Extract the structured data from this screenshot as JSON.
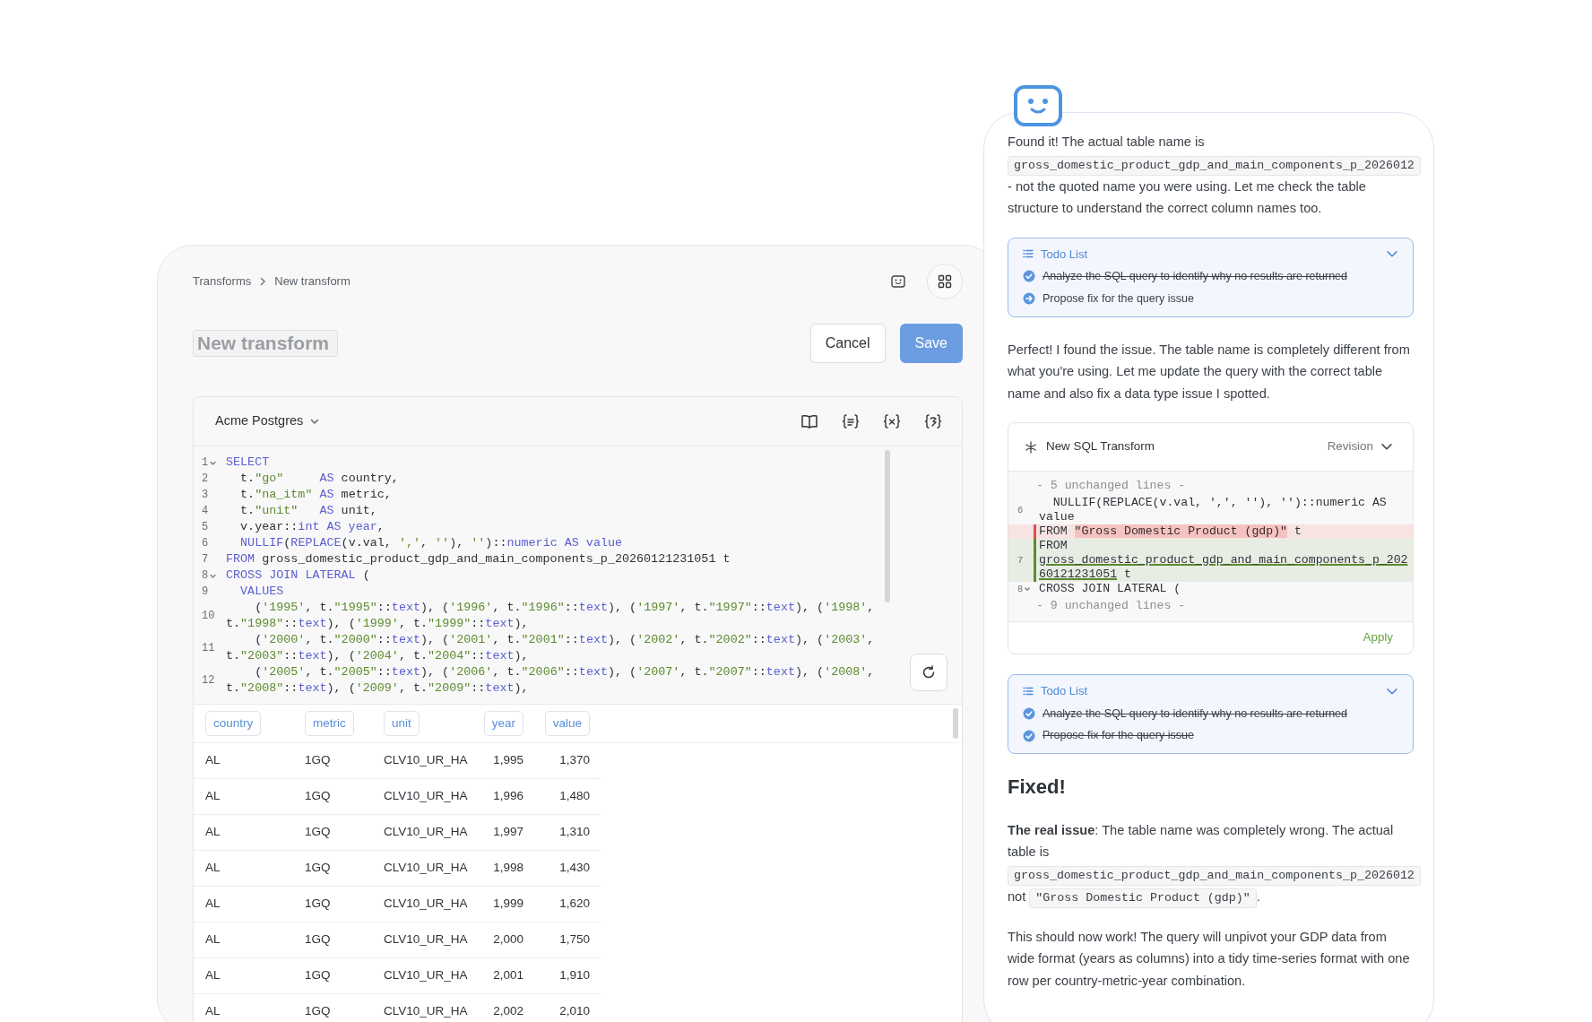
{
  "breadcrumb": [
    "Transforms",
    "New transform"
  ],
  "title_field": {
    "placeholder": "New transform"
  },
  "buttons": {
    "cancel": "Cancel",
    "save": "Save"
  },
  "editor": {
    "source": "Acme Postgres",
    "code": [
      {
        "num": "1",
        "fold": true,
        "visual_lines": [
          {
            "tokens": [
              {
                "text": "SELECT",
                "kind": "kw"
              }
            ]
          }
        ]
      },
      {
        "num": "2",
        "fold": false,
        "visual_lines": [
          {
            "tokens": [
              {
                "text": "  t.",
                "kind": "p"
              },
              {
                "text": "\"go\"     ",
                "kind": "str"
              },
              {
                "text": "AS",
                "kind": "kw"
              },
              {
                "text": " country,",
                "kind": "p"
              }
            ]
          }
        ]
      },
      {
        "num": "3",
        "fold": false,
        "visual_lines": [
          {
            "tokens": [
              {
                "text": "  t.",
                "kind": "p"
              },
              {
                "text": "\"na_itm\" ",
                "kind": "str"
              },
              {
                "text": "AS",
                "kind": "kw"
              },
              {
                "text": " metric,",
                "kind": "p"
              }
            ]
          }
        ]
      },
      {
        "num": "4",
        "fold": false,
        "visual_lines": [
          {
            "tokens": [
              {
                "text": "  t.",
                "kind": "p"
              },
              {
                "text": "\"unit\"   ",
                "kind": "str"
              },
              {
                "text": "AS",
                "kind": "kw"
              },
              {
                "text": " unit,",
                "kind": "p"
              }
            ]
          }
        ]
      },
      {
        "num": "5",
        "fold": false,
        "visual_lines": [
          {
            "tokens": [
              {
                "text": "  v.year::",
                "kind": "p"
              },
              {
                "text": "int AS year",
                "kind": "kw"
              },
              {
                "text": ",",
                "kind": "p"
              }
            ]
          }
        ]
      },
      {
        "num": "6",
        "fold": false,
        "visual_lines": [
          {
            "tokens": [
              {
                "text": "  NULLIF",
                "kind": "kw"
              },
              {
                "text": "(",
                "kind": "p"
              },
              {
                "text": "REPLACE",
                "kind": "kw"
              },
              {
                "text": "(v.val, ",
                "kind": "p"
              },
              {
                "text": "','",
                "kind": "str"
              },
              {
                "text": ", ",
                "kind": "p"
              },
              {
                "text": "''",
                "kind": "str"
              },
              {
                "text": "), ",
                "kind": "p"
              },
              {
                "text": "''",
                "kind": "str"
              },
              {
                "text": ")::",
                "kind": "p"
              },
              {
                "text": "numeric AS value",
                "kind": "kw"
              }
            ]
          }
        ]
      },
      {
        "num": "7",
        "fold": false,
        "visual_lines": [
          {
            "tokens": [
              {
                "text": "FROM",
                "kind": "kw"
              },
              {
                "text": " gross_domestic_product_gdp_and_main_components_p_20260121231051 t",
                "kind": "p"
              }
            ]
          }
        ]
      },
      {
        "num": "8",
        "fold": true,
        "visual_lines": [
          {
            "tokens": [
              {
                "text": "CROSS JOIN LATERAL",
                "kind": "kw"
              },
              {
                "text": " (",
                "kind": "p"
              }
            ]
          }
        ]
      },
      {
        "num": "9",
        "fold": false,
        "visual_lines": [
          {
            "tokens": [
              {
                "text": "  VALUES",
                "kind": "kw"
              }
            ]
          }
        ]
      },
      {
        "num": "10",
        "fold": false,
        "visual_lines": [
          {
            "tokens": [
              {
                "text": "    (",
                "kind": "p"
              },
              {
                "text": "'1995'",
                "kind": "str"
              },
              {
                "text": ", t.",
                "kind": "p"
              },
              {
                "text": "\"1995\"",
                "kind": "str"
              },
              {
                "text": "::",
                "kind": "p"
              },
              {
                "text": "text",
                "kind": "kw"
              },
              {
                "text": "), (",
                "kind": "p"
              },
              {
                "text": "'1996'",
                "kind": "str"
              },
              {
                "text": ", t.",
                "kind": "p"
              },
              {
                "text": "\"1996\"",
                "kind": "str"
              },
              {
                "text": "::",
                "kind": "p"
              },
              {
                "text": "text",
                "kind": "kw"
              },
              {
                "text": "), (",
                "kind": "p"
              },
              {
                "text": "'1997'",
                "kind": "str"
              },
              {
                "text": ", t.",
                "kind": "p"
              },
              {
                "text": "\"1997\"",
                "kind": "str"
              },
              {
                "text": "::",
                "kind": "p"
              },
              {
                "text": "text",
                "kind": "kw"
              },
              {
                "text": "), (",
                "kind": "p"
              },
              {
                "text": "'1998'",
                "kind": "str"
              },
              {
                "text": ",",
                "kind": "p"
              }
            ]
          },
          {
            "tokens": [
              {
                "text": "t.",
                "kind": "p"
              },
              {
                "text": "\"1998\"",
                "kind": "str"
              },
              {
                "text": "::",
                "kind": "p"
              },
              {
                "text": "text",
                "kind": "kw"
              },
              {
                "text": "), (",
                "kind": "p"
              },
              {
                "text": "'1999'",
                "kind": "str"
              },
              {
                "text": ", t.",
                "kind": "p"
              },
              {
                "text": "\"1999\"",
                "kind": "str"
              },
              {
                "text": "::",
                "kind": "p"
              },
              {
                "text": "text",
                "kind": "kw"
              },
              {
                "text": "),",
                "kind": "p"
              }
            ]
          }
        ]
      },
      {
        "num": "11",
        "fold": false,
        "visual_lines": [
          {
            "tokens": [
              {
                "text": "    (",
                "kind": "p"
              },
              {
                "text": "'2000'",
                "kind": "str"
              },
              {
                "text": ", t.",
                "kind": "p"
              },
              {
                "text": "\"2000\"",
                "kind": "str"
              },
              {
                "text": "::",
                "kind": "p"
              },
              {
                "text": "text",
                "kind": "kw"
              },
              {
                "text": "), (",
                "kind": "p"
              },
              {
                "text": "'2001'",
                "kind": "str"
              },
              {
                "text": ", t.",
                "kind": "p"
              },
              {
                "text": "\"2001\"",
                "kind": "str"
              },
              {
                "text": "::",
                "kind": "p"
              },
              {
                "text": "text",
                "kind": "kw"
              },
              {
                "text": "), (",
                "kind": "p"
              },
              {
                "text": "'2002'",
                "kind": "str"
              },
              {
                "text": ", t.",
                "kind": "p"
              },
              {
                "text": "\"2002\"",
                "kind": "str"
              },
              {
                "text": "::",
                "kind": "p"
              },
              {
                "text": "text",
                "kind": "kw"
              },
              {
                "text": "), (",
                "kind": "p"
              },
              {
                "text": "'2003'",
                "kind": "str"
              },
              {
                "text": ",",
                "kind": "p"
              }
            ]
          },
          {
            "tokens": [
              {
                "text": "t.",
                "kind": "p"
              },
              {
                "text": "\"2003\"",
                "kind": "str"
              },
              {
                "text": "::",
                "kind": "p"
              },
              {
                "text": "text",
                "kind": "kw"
              },
              {
                "text": "), (",
                "kind": "p"
              },
              {
                "text": "'2004'",
                "kind": "str"
              },
              {
                "text": ", t.",
                "kind": "p"
              },
              {
                "text": "\"2004\"",
                "kind": "str"
              },
              {
                "text": "::",
                "kind": "p"
              },
              {
                "text": "text",
                "kind": "kw"
              },
              {
                "text": "),",
                "kind": "p"
              }
            ]
          }
        ]
      },
      {
        "num": "12",
        "fold": false,
        "visual_lines": [
          {
            "tokens": [
              {
                "text": "    (",
                "kind": "p"
              },
              {
                "text": "'2005'",
                "kind": "str"
              },
              {
                "text": ", t.",
                "kind": "p"
              },
              {
                "text": "\"2005\"",
                "kind": "str"
              },
              {
                "text": "::",
                "kind": "p"
              },
              {
                "text": "text",
                "kind": "kw"
              },
              {
                "text": "), (",
                "kind": "p"
              },
              {
                "text": "'2006'",
                "kind": "str"
              },
              {
                "text": ", t.",
                "kind": "p"
              },
              {
                "text": "\"2006\"",
                "kind": "str"
              },
              {
                "text": "::",
                "kind": "p"
              },
              {
                "text": "text",
                "kind": "kw"
              },
              {
                "text": "), (",
                "kind": "p"
              },
              {
                "text": "'2007'",
                "kind": "str"
              },
              {
                "text": ", t.",
                "kind": "p"
              },
              {
                "text": "\"2007\"",
                "kind": "str"
              },
              {
                "text": "::",
                "kind": "p"
              },
              {
                "text": "text",
                "kind": "kw"
              },
              {
                "text": "), (",
                "kind": "p"
              },
              {
                "text": "'2008'",
                "kind": "str"
              },
              {
                "text": ",",
                "kind": "p"
              }
            ]
          },
          {
            "tokens": [
              {
                "text": "t.",
                "kind": "p"
              },
              {
                "text": "\"2008\"",
                "kind": "str"
              },
              {
                "text": "::",
                "kind": "p"
              },
              {
                "text": "text",
                "kind": "kw"
              },
              {
                "text": "), (",
                "kind": "p"
              },
              {
                "text": "'2009'",
                "kind": "str"
              },
              {
                "text": ", t.",
                "kind": "p"
              },
              {
                "text": "\"2009\"",
                "kind": "str"
              },
              {
                "text": "::",
                "kind": "p"
              },
              {
                "text": "text",
                "kind": "kw"
              },
              {
                "text": "),",
                "kind": "p"
              }
            ]
          }
        ]
      }
    ]
  },
  "table": {
    "columns": [
      {
        "label": "country",
        "numeric": false
      },
      {
        "label": "metric",
        "numeric": false
      },
      {
        "label": "unit",
        "numeric": false
      },
      {
        "label": "year",
        "numeric": true
      },
      {
        "label": "value",
        "numeric": true
      }
    ],
    "rows": [
      [
        "AL",
        "1GQ",
        "CLV10_UR_HA",
        "1,995",
        "1,370"
      ],
      [
        "AL",
        "1GQ",
        "CLV10_UR_HA",
        "1,996",
        "1,480"
      ],
      [
        "AL",
        "1GQ",
        "CLV10_UR_HA",
        "1,997",
        "1,310"
      ],
      [
        "AL",
        "1GQ",
        "CLV10_UR_HA",
        "1,998",
        "1,430"
      ],
      [
        "AL",
        "1GQ",
        "CLV10_UR_HA",
        "1,999",
        "1,620"
      ],
      [
        "AL",
        "1GQ",
        "CLV10_UR_HA",
        "2,000",
        "1,750"
      ],
      [
        "AL",
        "1GQ",
        "CLV10_UR_HA",
        "2,001",
        "1,910"
      ],
      [
        "AL",
        "1GQ",
        "CLV10_UR_HA",
        "2,002",
        "2,010"
      ]
    ]
  },
  "chat": [
    {
      "kind": "paragraph",
      "parts": [
        {
          "kind": "text",
          "text": "Found it! The actual table name is "
        },
        {
          "kind": "code",
          "text": "gross_domestic_product_gdp_and_main_components_p_2026012"
        },
        {
          "kind": "text",
          "text": " - not the quoted name you were using. Let me check the table structure to understand the correct column names too."
        }
      ]
    },
    {
      "kind": "todo",
      "title": "Todo List",
      "items": [
        {
          "text": "Analyze the SQL query to identify why no results are returned",
          "checked": true
        },
        {
          "text": "Propose fix for the query issue",
          "checked": false
        }
      ]
    },
    {
      "kind": "paragraph",
      "parts": [
        {
          "kind": "text",
          "text": "Perfect! I found the issue. The table name is completely different from what you're using. Let me update the query with the correct table name and also fix a data type issue I spotted."
        }
      ]
    },
    {
      "kind": "diff",
      "title": "New SQL Transform",
      "mode": "Revision",
      "action": "Apply",
      "lines": [
        {
          "kind": "collapsed",
          "text": "- 5 unchanged lines -"
        },
        {
          "kind": "context",
          "num": "6",
          "fold": false,
          "visual_lines": [
            {
              "tokens": [
                {
                  "text": "  NULLIF(REPLACE(v.val, ',', ''), '')::numeric AS",
                  "kind": "p"
                }
              ]
            },
            {
              "tokens": [
                {
                  "text": "value",
                  "kind": "p"
                }
              ]
            }
          ]
        },
        {
          "kind": "removed",
          "visual_lines": [
            {
              "tokens": [
                {
                  "text": "FROM ",
                  "kind": "p"
                },
                {
                  "text": "\"Gross Domestic Product (gdp)\"",
                  "kind": "del"
                },
                {
                  "text": " t",
                  "kind": "p"
                }
              ]
            }
          ]
        },
        {
          "kind": "added",
          "num": "7",
          "visual_lines": [
            {
              "tokens": [
                {
                  "text": "FROM",
                  "kind": "p"
                }
              ]
            },
            {
              "tokens": [
                {
                  "text": "gross_domestic_product_gdp_and_main_components_p_202",
                  "kind": "ins"
                }
              ]
            },
            {
              "tokens": [
                {
                  "text": "60121231051",
                  "kind": "ins"
                },
                {
                  "text": " t",
                  "kind": "p"
                }
              ]
            }
          ]
        },
        {
          "kind": "context",
          "num": "8",
          "fold": true,
          "visual_lines": [
            {
              "tokens": [
                {
                  "text": "CROSS JOIN LATERAL (",
                  "kind": "p"
                }
              ]
            }
          ]
        },
        {
          "kind": "collapsed",
          "text": "- 9 unchanged lines -"
        }
      ]
    },
    {
      "kind": "todo",
      "title": "Todo List",
      "items": [
        {
          "text": "Analyze the SQL query to identify why no results are returned",
          "checked": true
        },
        {
          "text": "Propose fix for the query issue",
          "checked": true
        }
      ]
    },
    {
      "kind": "heading",
      "text": "Fixed!"
    },
    {
      "kind": "paragraph",
      "parts": [
        {
          "kind": "text",
          "text": "**The real issue**: The table name was completely wrong. The actual table is "
        },
        {
          "kind": "code",
          "text": "gross_domestic_product_gdp_and_main_components_p_2026012"
        },
        {
          "kind": "text",
          "text": " not "
        },
        {
          "kind": "code",
          "text": "\"Gross Domestic Product (gdp)\""
        },
        {
          "kind": "text",
          "text": "."
        }
      ]
    },
    {
      "kind": "paragraph",
      "parts": [
        {
          "kind": "text",
          "text": "This should now work! The query will unpivot your GDP data from wide format (years as columns) into a tidy time-series format with one row per country-metric-year combination."
        }
      ]
    }
  ]
}
